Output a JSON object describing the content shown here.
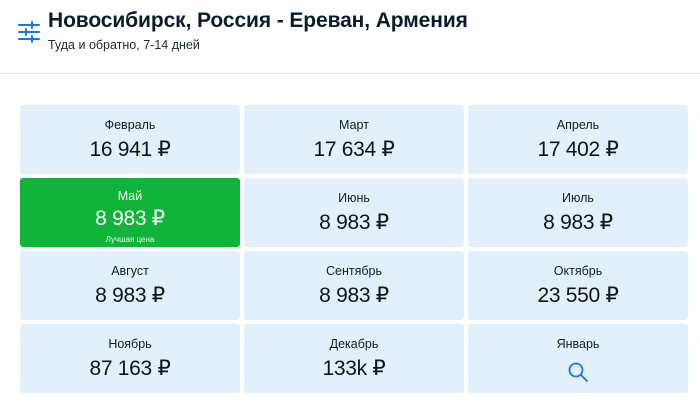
{
  "header": {
    "title": "Новосибирск, Россия - Ереван, Армения",
    "subtitle": "Туда и обратно, 7-14 дней",
    "filter_icon": "sliders-icon"
  },
  "colors": {
    "cell_bg": "#e3effb",
    "best_bg": "#11b33a",
    "accent": "#1a73e8"
  },
  "months": [
    {
      "month": "Февраль",
      "price": "16 941 ₽"
    },
    {
      "month": "Март",
      "price": "17 634 ₽"
    },
    {
      "month": "Апрель",
      "price": "17 402 ₽"
    },
    {
      "month": "Май",
      "price": "8 983 ₽",
      "note": "Лучшая цена"
    },
    {
      "month": "Июнь",
      "price": "8 983 ₽"
    },
    {
      "month": "Июль",
      "price": "8 983 ₽"
    },
    {
      "month": "Август",
      "price": "8 983 ₽"
    },
    {
      "month": "Сентябрь",
      "price": "8 983 ₽"
    },
    {
      "month": "Октябрь",
      "price": "23 550 ₽"
    },
    {
      "month": "Ноябрь",
      "price": "87 163 ₽"
    },
    {
      "month": "Декабрь",
      "price": "133k ₽"
    },
    {
      "month": "Январь",
      "icon": "search-icon"
    }
  ]
}
